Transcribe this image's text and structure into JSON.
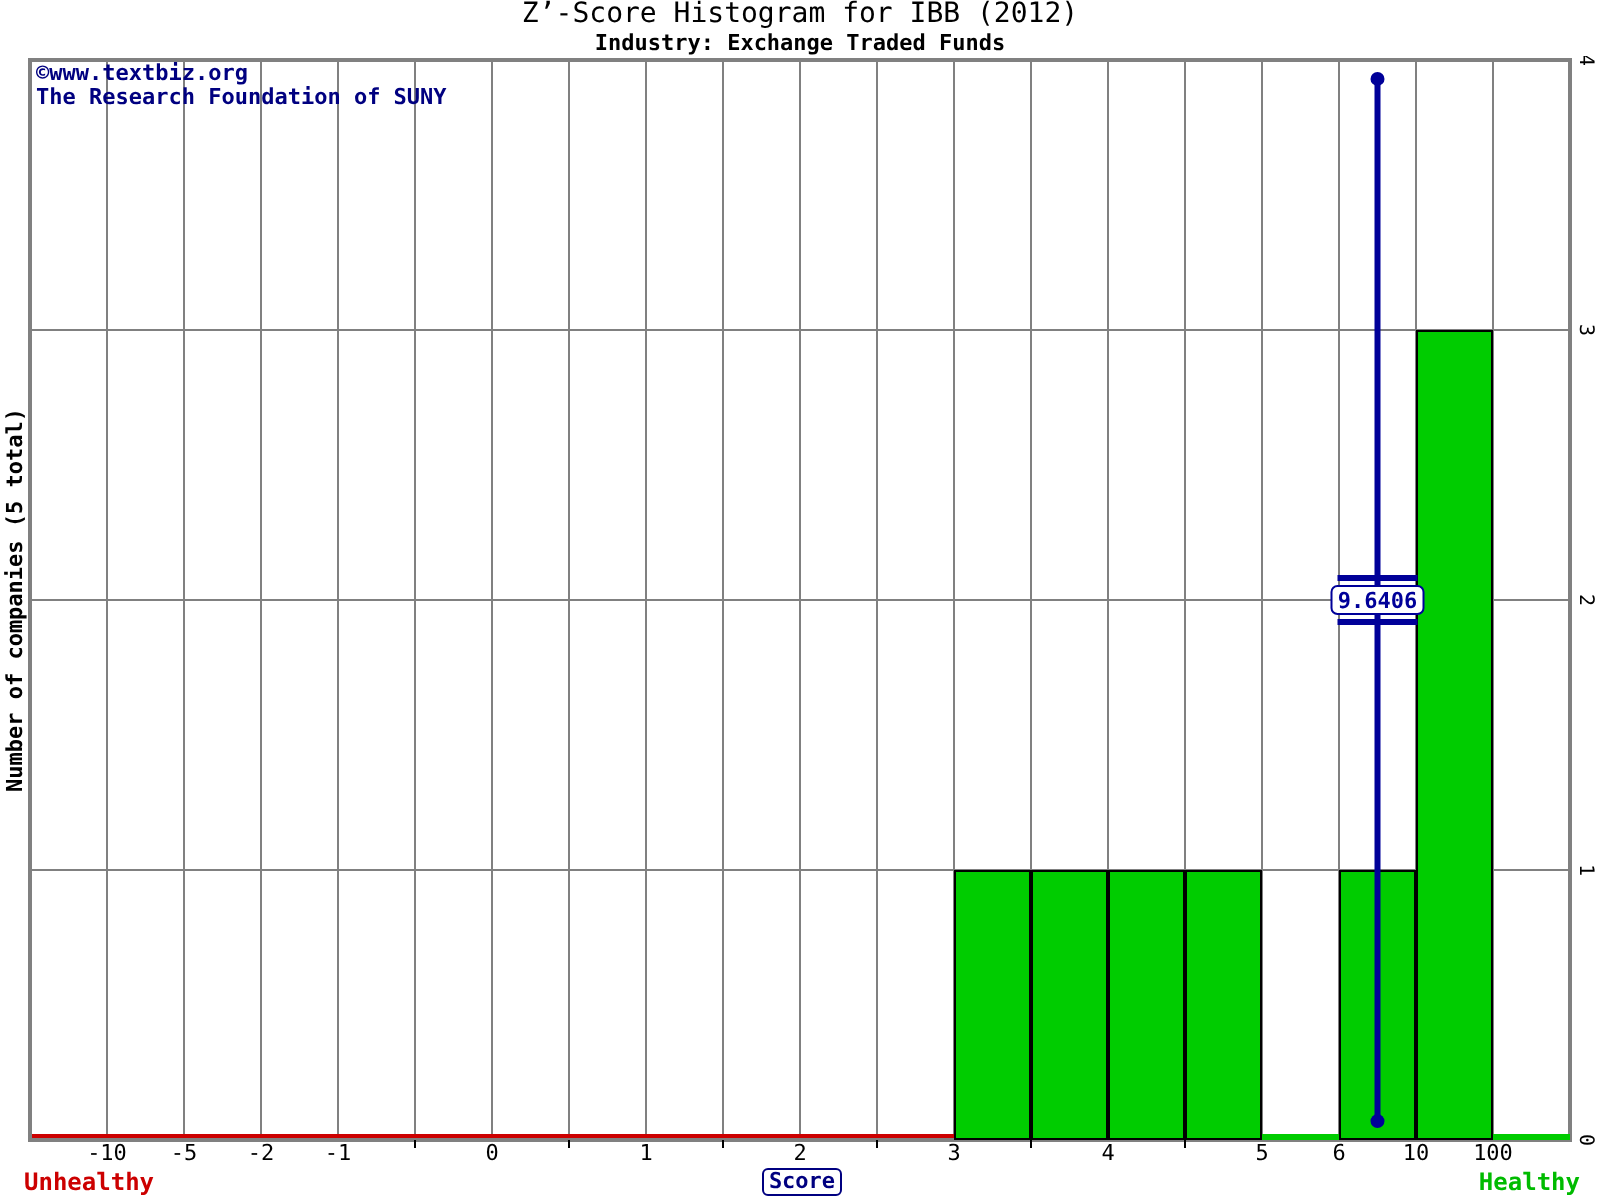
{
  "title": "Z’-Score Histogram for IBB (2012)",
  "subtitle": "Industry: Exchange Traded Funds",
  "credits": [
    "©www.textbiz.org",
    "The Research Foundation of SUNY"
  ],
  "chart_data": {
    "type": "bar",
    "xlabel": "Score",
    "ylabel": "Number of companies (5 total)",
    "categories": [
      null,
      "-10",
      "-5",
      "-2",
      "-1",
      null,
      "0",
      null,
      "1",
      null,
      "2",
      null,
      "3",
      null,
      "4",
      null,
      "5",
      "6",
      "10",
      "100"
    ],
    "ylim": [
      0,
      4
    ],
    "grid": true,
    "series": [
      {
        "color": "#00cc00",
        "values": [
          null,
          null,
          null,
          null,
          null,
          null,
          null,
          null,
          null,
          null,
          null,
          null,
          1,
          1,
          1,
          1,
          0,
          1,
          3,
          0
        ]
      }
    ],
    "yticks": [
      0,
      1,
      2,
      3,
      4
    ],
    "annotations": [
      "9.6406"
    ]
  },
  "footer": {
    "left": "Unhealthy",
    "right": "Healthy"
  }
}
